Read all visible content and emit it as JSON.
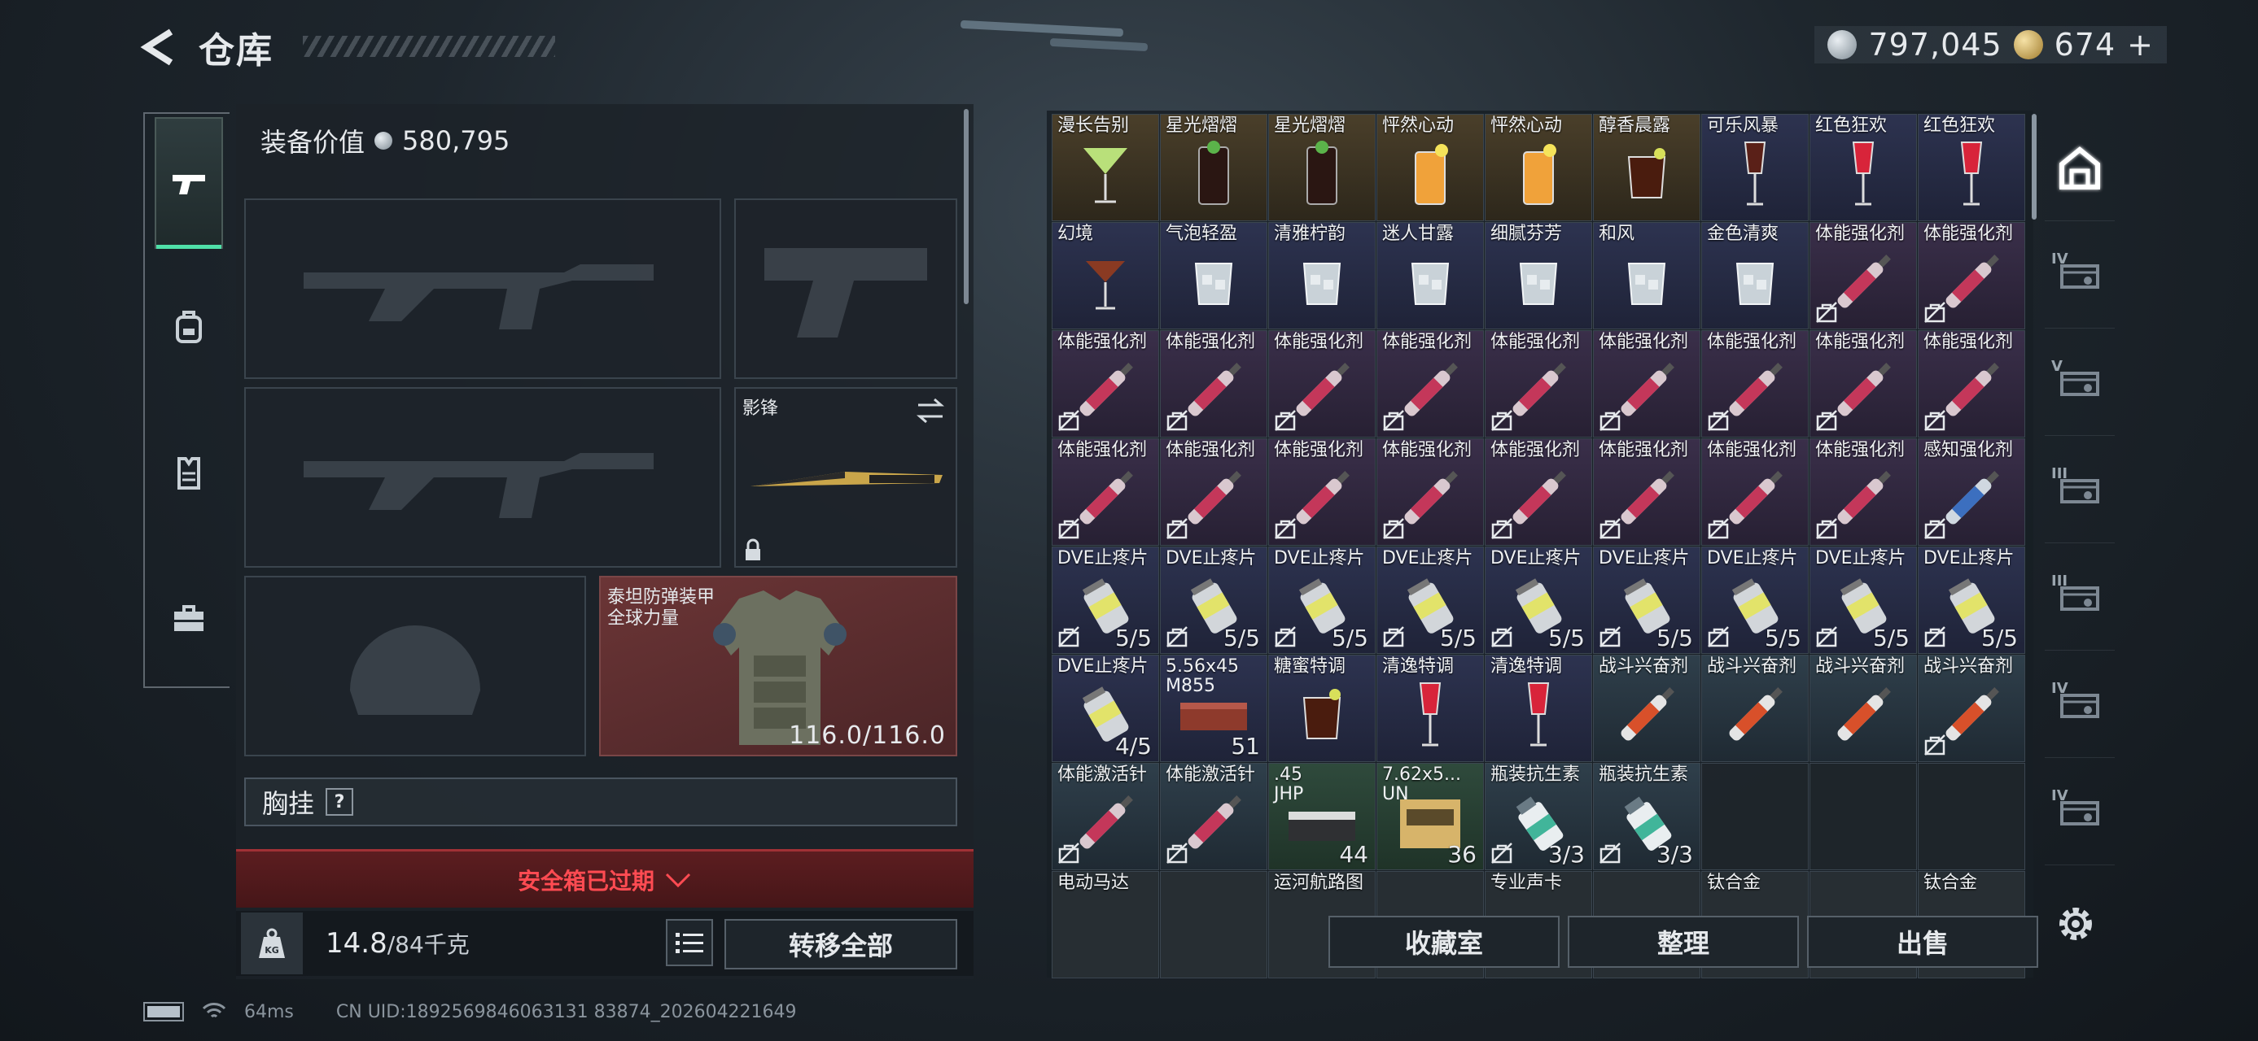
{
  "header": {
    "title": "仓库"
  },
  "currency": {
    "silver": "797,045",
    "gold": "674",
    "gold_suffix": "+"
  },
  "equipment": {
    "value_label": "装备价值",
    "value": "580,795",
    "knife_name": "影锋",
    "armor_name": "泰坦防弹装甲",
    "armor_brand": "全球力量",
    "armor_durability": "116.0/116.0",
    "chest_label": "胸挂",
    "chest_help": "?",
    "safebox_text": "安全箱已过期",
    "weight_value": "14.8",
    "weight_cap": "/84千克",
    "kg_label": "KG",
    "transfer_label": "转移全部"
  },
  "inventory": {
    "rows": [
      [
        {
          "name": "漫长告别",
          "color": "amber",
          "art": "cocktail"
        },
        {
          "name": "星光熠熠",
          "color": "amber",
          "art": "tall-glass"
        },
        {
          "name": "星光熠熠",
          "color": "amber",
          "art": "tall-glass"
        },
        {
          "name": "怦然心动",
          "color": "amber",
          "art": "orange-glass"
        },
        {
          "name": "怦然心动",
          "color": "amber",
          "art": "orange-glass"
        },
        {
          "name": "醇香晨露",
          "color": "amber",
          "art": "tumbler"
        },
        {
          "name": "可乐风暴",
          "color": "navy",
          "art": "wine"
        },
        {
          "name": "红色狂欢",
          "color": "navy",
          "art": "red-wine"
        },
        {
          "name": "红色狂欢",
          "color": "navy",
          "art": "red-wine"
        }
      ],
      [
        {
          "name": "幻境",
          "color": "navy",
          "art": "martini"
        },
        {
          "name": "气泡轻盈",
          "color": "navy",
          "art": "ice-glass"
        },
        {
          "name": "清雅柠韵",
          "color": "navy",
          "art": "ice-glass"
        },
        {
          "name": "迷人甘露",
          "color": "navy",
          "art": "ice-glass"
        },
        {
          "name": "细腻芬芳",
          "color": "navy",
          "art": "ice-glass"
        },
        {
          "name": "和风",
          "color": "navy",
          "art": "ice-glass"
        },
        {
          "name": "金色清爽",
          "color": "navy",
          "art": "ice-glass"
        },
        {
          "name": "体能强化剂",
          "color": "purple",
          "art": "injector",
          "nobag": true
        },
        {
          "name": "体能强化剂",
          "color": "purple",
          "art": "injector",
          "nobag": true
        }
      ],
      [
        {
          "name": "体能强化剂",
          "color": "purple",
          "art": "injector",
          "nobag": true
        },
        {
          "name": "体能强化剂",
          "color": "purple",
          "art": "injector",
          "nobag": true
        },
        {
          "name": "体能强化剂",
          "color": "purple",
          "art": "injector",
          "nobag": true
        },
        {
          "name": "体能强化剂",
          "color": "purple",
          "art": "injector",
          "nobag": true
        },
        {
          "name": "体能强化剂",
          "color": "purple",
          "art": "injector",
          "nobag": true
        },
        {
          "name": "体能强化剂",
          "color": "purple",
          "art": "injector",
          "nobag": true
        },
        {
          "name": "体能强化剂",
          "color": "purple",
          "art": "injector",
          "nobag": true
        },
        {
          "name": "体能强化剂",
          "color": "purple",
          "art": "injector",
          "nobag": true
        },
        {
          "name": "体能强化剂",
          "color": "purple",
          "art": "injector",
          "nobag": true
        }
      ],
      [
        {
          "name": "体能强化剂",
          "color": "purple",
          "art": "injector",
          "nobag": true
        },
        {
          "name": "体能强化剂",
          "color": "purple",
          "art": "injector",
          "nobag": true
        },
        {
          "name": "体能强化剂",
          "color": "purple",
          "art": "injector",
          "nobag": true
        },
        {
          "name": "体能强化剂",
          "color": "purple",
          "art": "injector",
          "nobag": true
        },
        {
          "name": "体能强化剂",
          "color": "purple",
          "art": "injector",
          "nobag": true
        },
        {
          "name": "体能强化剂",
          "color": "purple",
          "art": "injector",
          "nobag": true
        },
        {
          "name": "体能强化剂",
          "color": "purple",
          "art": "injector",
          "nobag": true
        },
        {
          "name": "体能强化剂",
          "color": "purple",
          "art": "injector",
          "nobag": true
        },
        {
          "name": "感知强化剂",
          "color": "purple",
          "art": "injector-blue",
          "nobag": true
        }
      ],
      [
        {
          "name": "DVE止疼片",
          "color": "navy",
          "art": "pill",
          "count": "5/5",
          "nobag": true
        },
        {
          "name": "DVE止疼片",
          "color": "navy",
          "art": "pill",
          "count": "5/5",
          "nobag": true
        },
        {
          "name": "DVE止疼片",
          "color": "navy",
          "art": "pill",
          "count": "5/5",
          "nobag": true
        },
        {
          "name": "DVE止疼片",
          "color": "navy",
          "art": "pill",
          "count": "5/5",
          "nobag": true
        },
        {
          "name": "DVE止疼片",
          "color": "navy",
          "art": "pill",
          "count": "5/5",
          "nobag": true
        },
        {
          "name": "DVE止疼片",
          "color": "navy",
          "art": "pill",
          "count": "5/5",
          "nobag": true
        },
        {
          "name": "DVE止疼片",
          "color": "navy",
          "art": "pill",
          "count": "5/5",
          "nobag": true
        },
        {
          "name": "DVE止疼片",
          "color": "navy",
          "art": "pill",
          "count": "5/5",
          "nobag": true
        },
        {
          "name": "DVE止疼片",
          "color": "navy",
          "art": "pill",
          "count": "5/5",
          "nobag": true
        }
      ],
      [
        {
          "name": "DVE止疼片",
          "color": "navy",
          "art": "pill",
          "count": "4/5"
        },
        {
          "name": "5.56x45",
          "sub": "M855",
          "color": "navy",
          "art": "ammo-box",
          "count": "51"
        },
        {
          "name": "糖蜜特调",
          "color": "navy",
          "art": "tumbler"
        },
        {
          "name": "清逸特调",
          "color": "navy",
          "art": "red-wine"
        },
        {
          "name": "清逸特调",
          "color": "navy",
          "art": "red-wine"
        },
        {
          "name": "战斗兴奋剂",
          "color": "slate",
          "art": "injector-red"
        },
        {
          "name": "战斗兴奋剂",
          "color": "slate",
          "art": "injector-red"
        },
        {
          "name": "战斗兴奋剂",
          "color": "slate",
          "art": "injector-red"
        },
        {
          "name": "战斗兴奋剂",
          "color": "slate",
          "art": "injector-red",
          "nobag": true
        }
      ],
      [
        {
          "name": "体能激活针",
          "color": "slate",
          "art": "injector",
          "nobag": true
        },
        {
          "name": "体能激活针",
          "color": "slate",
          "art": "injector",
          "nobag": true
        },
        {
          "name": ".45",
          "sub": "JHP",
          "color": "green",
          "art": "ammo-box-green",
          "count": "44"
        },
        {
          "name": "7.62x5...",
          "sub": "UN",
          "color": "green",
          "art": "ammo-box-tan",
          "count": "36"
        },
        {
          "name": "瓶装抗生素",
          "color": "slate",
          "art": "bottle",
          "count": "3/3",
          "nobag": true
        },
        {
          "name": "瓶装抗生素",
          "color": "slate",
          "art": "bottle",
          "count": "3/3",
          "nobag": true
        },
        {
          "name": "",
          "color": "empty"
        },
        {
          "name": "",
          "color": "empty"
        },
        {
          "name": "",
          "color": "empty"
        }
      ],
      [
        {
          "name": "电动马达",
          "color": "partial"
        },
        {
          "name": "",
          "color": "partial"
        },
        {
          "name": "运河航路图",
          "color": "partial"
        },
        {
          "name": "",
          "color": "partial"
        },
        {
          "name": "专业声卡",
          "color": "partial"
        },
        {
          "name": "",
          "color": "partial"
        },
        {
          "name": "钛合金",
          "color": "partial"
        },
        {
          "name": "",
          "color": "partial"
        },
        {
          "name": "钛合金",
          "color": "partial"
        }
      ]
    ]
  },
  "actions": {
    "collection": "收藏室",
    "sort": "整理",
    "sell": "出售"
  },
  "categories": [
    {
      "icon": "storage-icon",
      "tier": ""
    },
    {
      "icon": "armor-tier-icon",
      "tier": "IV"
    },
    {
      "icon": "armor-tier-icon",
      "tier": "V"
    },
    {
      "icon": "armor-tier-icon",
      "tier": "III"
    },
    {
      "icon": "armor-tier-icon",
      "tier": "III"
    },
    {
      "icon": "armor-tier-icon",
      "tier": "IV"
    },
    {
      "icon": "armor-tier-icon",
      "tier": "IV"
    }
  ],
  "footer": {
    "ping": "64ms",
    "uid": "CN UID:1892569846063131 83874_202604221649"
  },
  "colors": {
    "accent": "#4fe0a8",
    "danger": "#ff4b52",
    "armor_bg": "#5c2c2e"
  }
}
